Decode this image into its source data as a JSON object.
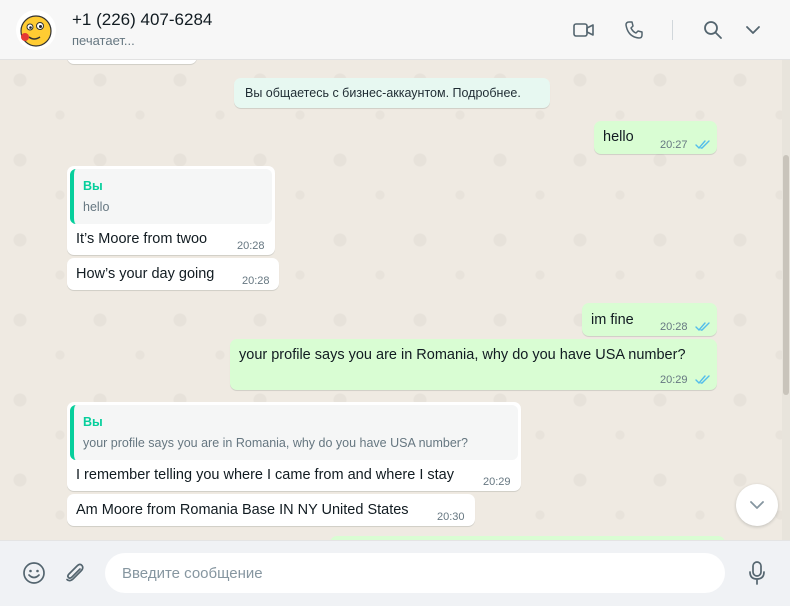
{
  "header": {
    "contact_name": "+1 (226) 407-6284",
    "status": "печатает...",
    "icons": [
      "avatar",
      "video-call-icon",
      "voice-call-icon",
      "search-icon",
      "chevron-down-icon"
    ]
  },
  "chat": {
    "system_notice": "Вы общаетесь с бизнес-аккаунтом. Подробнее.",
    "messages": [
      {
        "dir": "out",
        "text": "hello",
        "time": "20:27",
        "ticks": "read"
      },
      {
        "dir": "in",
        "quote_author": "Вы",
        "quote_text": "hello",
        "text": "It’s Moore from twoo",
        "time": "20:28"
      },
      {
        "dir": "in",
        "text": "How’s your day going",
        "time": "20:28"
      },
      {
        "dir": "out",
        "text": "im fine",
        "time": "20:28",
        "ticks": "read"
      },
      {
        "dir": "out",
        "text": "your profile says you are in Romania, why do you have USA number?",
        "time": "20:29",
        "ticks": "read"
      },
      {
        "dir": "in",
        "quote_author": "Вы",
        "quote_text": "your profile says you are in Romania, why do you have USA number?",
        "text": "I remember telling you where I came from and where I stay",
        "time": "20:29"
      },
      {
        "dir": "in",
        "text": "Am Moore from  Romania Base IN NY United States",
        "time": "20:30"
      }
    ]
  },
  "composer": {
    "placeholder": "Введите сообщение"
  },
  "colors": {
    "outgoing": "#d9fdd3",
    "incoming": "#ffffff",
    "read_ticks": "#53bdeb",
    "quote_accent": "#06cf9c",
    "background": "#efeae2"
  }
}
